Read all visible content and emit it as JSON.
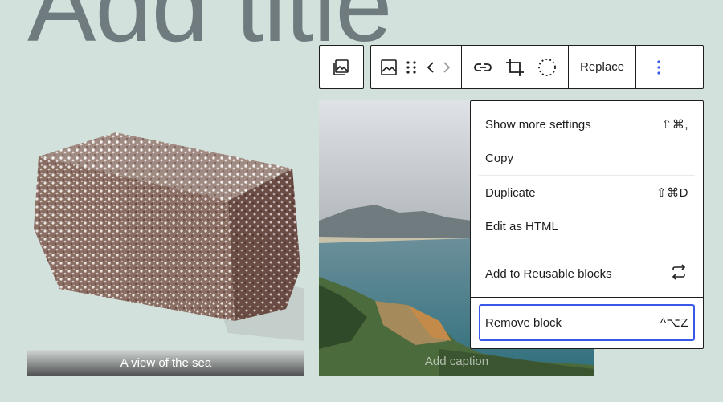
{
  "page": {
    "title": "Add title"
  },
  "figures": {
    "left_caption": "A view of the sea",
    "right_caption_placeholder": "Add caption"
  },
  "toolbar": {
    "replace_label": "Replace",
    "icons": [
      "image-icon",
      "drag-handle-icon",
      "chevron-left-icon",
      "chevron-right-icon",
      "link-icon",
      "crop-icon",
      "select-circle-icon",
      "more-vertical-icon"
    ]
  },
  "menu": {
    "sections": [
      {
        "items": [
          {
            "label": "Show more settings",
            "shortcut": "⇧⌘,"
          },
          {
            "label": "Copy",
            "shortcut": ""
          },
          {
            "label": "Duplicate",
            "shortcut": "⇧⌘D"
          },
          {
            "label": "Edit as HTML",
            "shortcut": ""
          }
        ]
      },
      {
        "items": [
          {
            "label": "Add to Reusable blocks",
            "icon": "reusable-icon"
          }
        ]
      },
      {
        "items": [
          {
            "label": "Remove block",
            "shortcut": "^⌥Z"
          }
        ]
      }
    ]
  },
  "colors": {
    "background": "#d3e1dc",
    "accent": "#3858e9",
    "title": "#6f7b7f"
  }
}
